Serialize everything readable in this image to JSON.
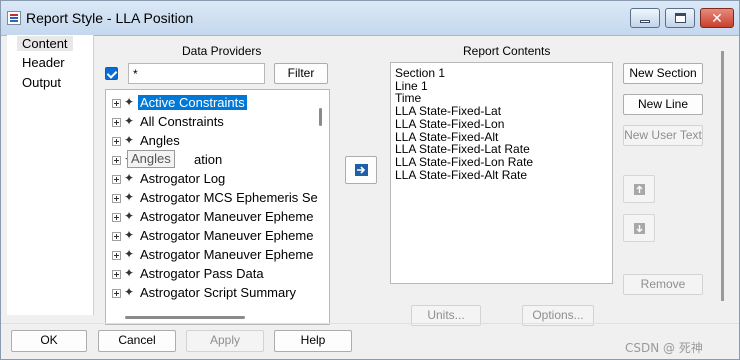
{
  "window": {
    "title": "Report Style - LLA Position",
    "minimize_icon": "minimize-icon",
    "maximize_icon": "maximize-icon",
    "close_icon": "close-icon",
    "close_glyph": "✕"
  },
  "nav": {
    "items": [
      {
        "label": "Content",
        "selected": true
      },
      {
        "label": "Header",
        "selected": false
      },
      {
        "label": "Output",
        "selected": false
      }
    ]
  },
  "data_providers": {
    "heading": "Data Providers",
    "filter_enabled": true,
    "filter_value": "*",
    "filter_button": "Filter",
    "items": [
      {
        "label": "Active Constraints",
        "selected": true
      },
      {
        "label": "All Constraints",
        "selected": false
      },
      {
        "label": "Angles",
        "selected": false
      },
      {
        "label": "Angles",
        "selected": false
      },
      {
        "label": "Astrogator Log",
        "selected": false
      },
      {
        "label": "Astrogator MCS Ephemeris Se",
        "selected": false
      },
      {
        "label": "Astrogator Maneuver Epheme",
        "selected": false
      },
      {
        "label": "Astrogator Maneuver Epheme",
        "selected": false
      },
      {
        "label": "Astrogator Maneuver Epheme",
        "selected": false
      },
      {
        "label": "Astrogator Pass Data",
        "selected": false
      },
      {
        "label": "Astrogator Script Summary",
        "selected": false
      }
    ],
    "obscured_row_fragment": "ation",
    "tooltip": "Angles",
    "item_icon": "satellite-icon"
  },
  "add_button_icon": "arrow-right-icon",
  "report_contents": {
    "heading": "Report Contents",
    "items": [
      "Section 1",
      "Line 1",
      "Time",
      "LLA State-Fixed-Lat",
      "LLA State-Fixed-Lon",
      "LLA State-Fixed-Alt",
      "LLA State-Fixed-Lat Rate",
      "LLA State-Fixed-Lon Rate",
      "LLA State-Fixed-Alt Rate"
    ]
  },
  "side_buttons": {
    "new_section": "New Section",
    "new_line": "New Line",
    "new_user_text": "New User Text",
    "move_up_icon": "arrow-up-icon",
    "move_down_icon": "arrow-down-icon",
    "remove": "Remove"
  },
  "bottom_buttons": {
    "units": "Units...",
    "options": "Options..."
  },
  "footer": {
    "ok": "OK",
    "cancel": "Cancel",
    "apply": "Apply",
    "help": "Help"
  },
  "watermark": "CSDN @ 死神",
  "colors": {
    "selection": "#0078d7",
    "checkbox": "#0a6cd6",
    "window_bg": "#f0f0f0"
  }
}
